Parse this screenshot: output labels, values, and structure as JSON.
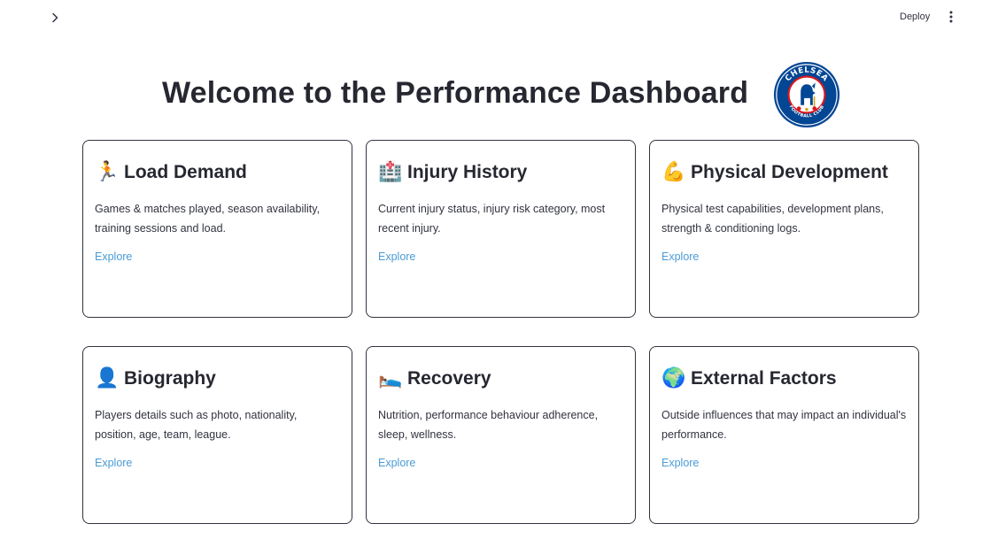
{
  "header": {
    "deploy_label": "Deploy",
    "expand_icon": "chevron-right-icon",
    "menu_icon": "kebab-menu-icon"
  },
  "main": {
    "title": "Welcome to the Performance Dashboard",
    "logo": {
      "text_top": "CHELSEA",
      "text_bottom": "FOOTBALL CLUB",
      "colors": {
        "blue": "#034694",
        "red": "#d71920",
        "gold": "#dba111"
      }
    }
  },
  "cards": [
    {
      "emoji": "🏃",
      "title": "Load Demand",
      "description": "Games & matches played, season availability, training sessions and load.",
      "link": "Explore"
    },
    {
      "emoji": "🏥",
      "title": "Injury History",
      "description": "Current injury status, injury risk category, most recent injury.",
      "link": "Explore"
    },
    {
      "emoji": "💪",
      "title": "Physical Development",
      "description": "Physical test capabilities, development plans, strength & conditioning logs.",
      "link": "Explore"
    },
    {
      "emoji": "👤",
      "title": "Biography",
      "description": "Players details such as photo, nationality, position, age, team, league.",
      "link": "Explore"
    },
    {
      "emoji": "🛌",
      "title": "Recovery",
      "description": "Nutrition, performance behaviour adherence, sleep, wellness.",
      "link": "Explore"
    },
    {
      "emoji": "🌍",
      "title": "External Factors",
      "description": "Outside influences that may impact an individual's performance.",
      "link": "Explore"
    }
  ],
  "theme": {
    "link_color": "#4a9bd6",
    "text_color": "#31333f",
    "border_color": "#31333f"
  }
}
